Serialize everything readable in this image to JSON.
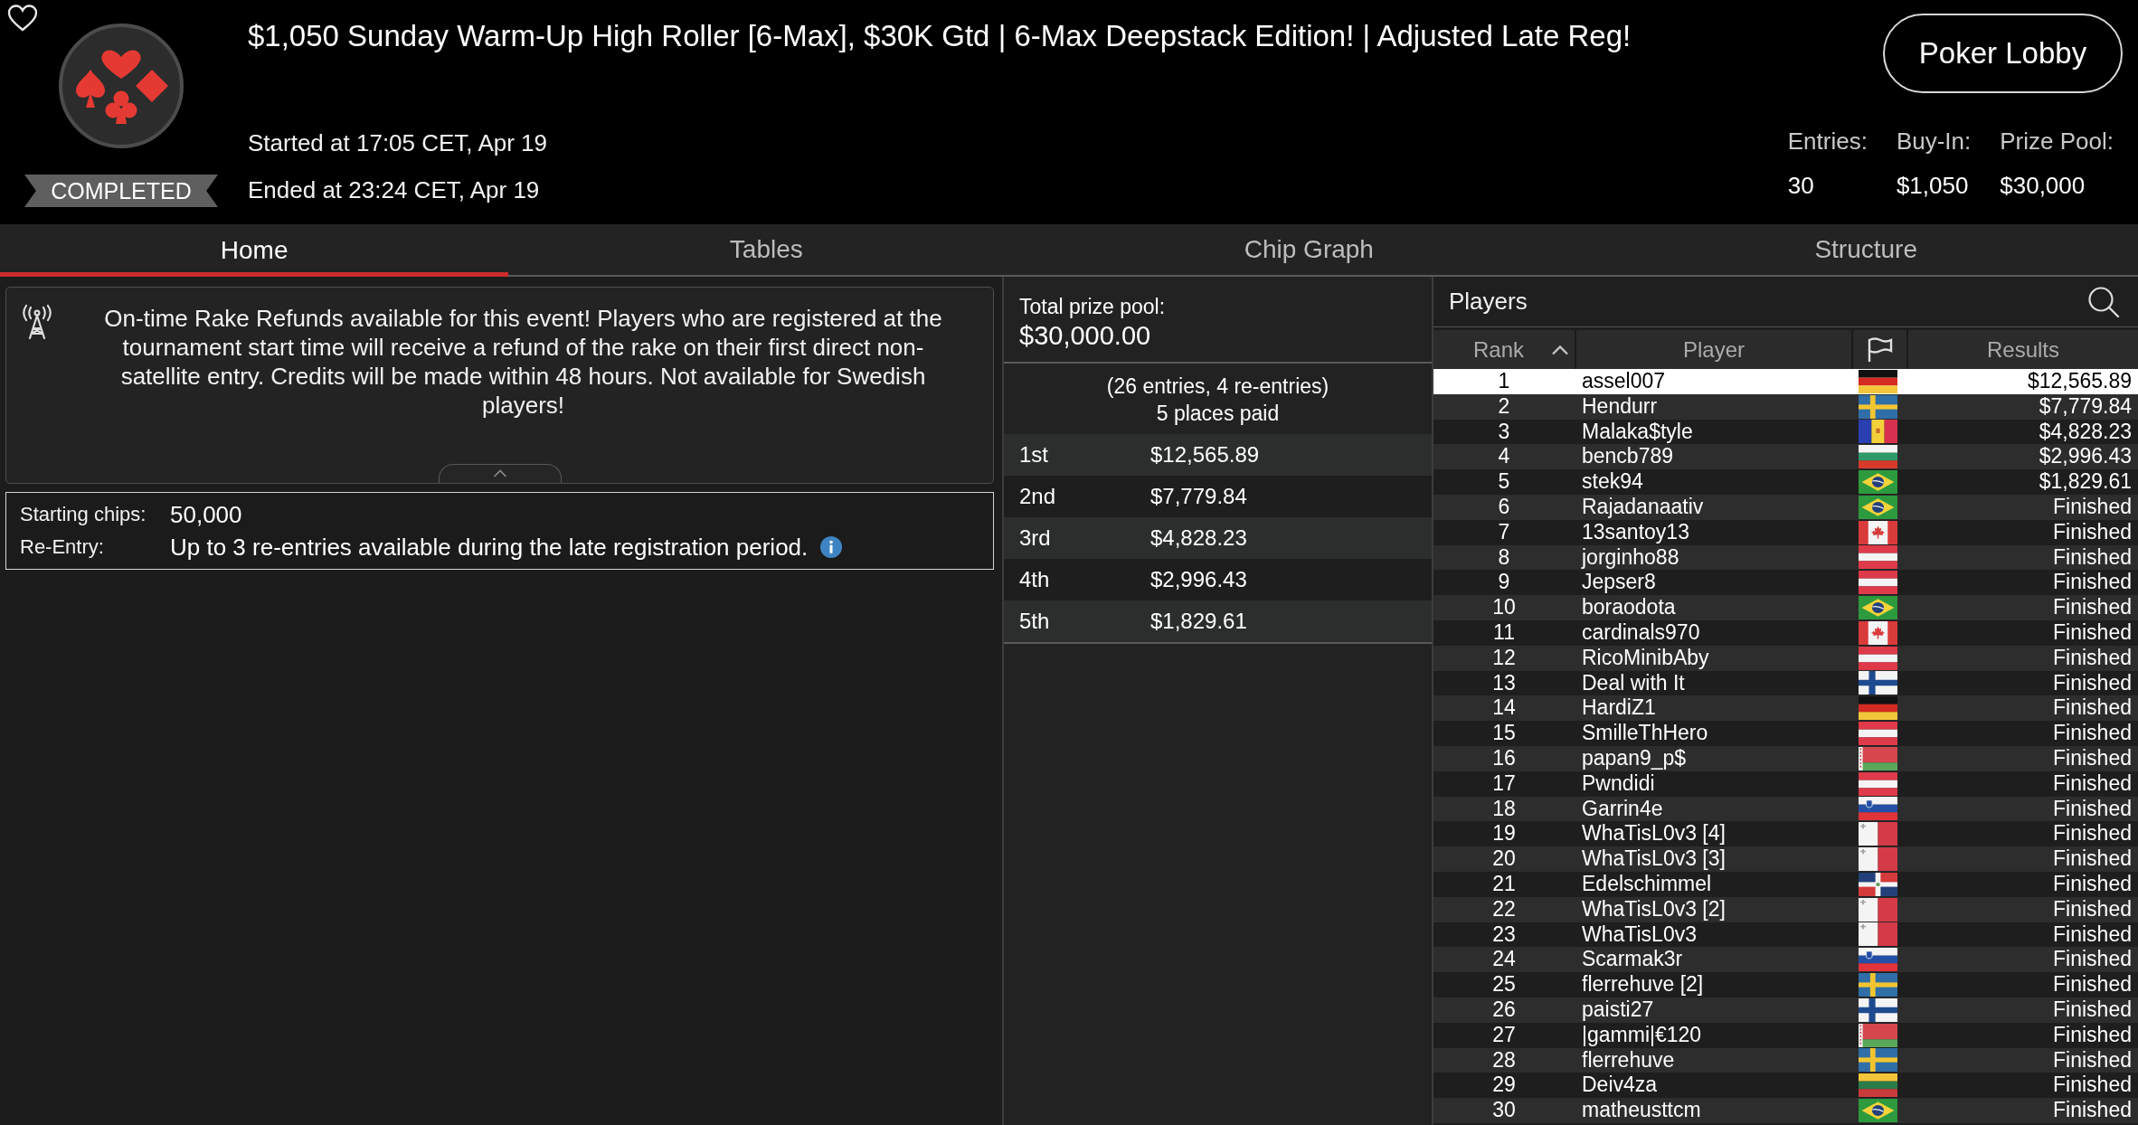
{
  "header": {
    "title": "$1,050 Sunday Warm-Up High Roller [6-Max], $30K Gtd | 6-Max Deepstack Edition! | Adjusted Late Reg!",
    "status": "COMPLETED",
    "started": "Started at 17:05 CET, Apr 19",
    "ended": "Ended at 23:24 CET, Apr 19",
    "lobby_button": "Poker Lobby",
    "stats": [
      {
        "label": "Entries:",
        "value": "30"
      },
      {
        "label": "Buy-In:",
        "value": "$1,050"
      },
      {
        "label": "Prize Pool:",
        "value": "$30,000"
      }
    ]
  },
  "tabs": [
    {
      "label": "Home",
      "selected": true
    },
    {
      "label": "Tables",
      "selected": false
    },
    {
      "label": "Chip Graph",
      "selected": false
    },
    {
      "label": "Structure",
      "selected": false
    }
  ],
  "notice": {
    "text": "On-time Rake Refunds available for this event! Players who are registered at the tournament start time will receive a refund of the rake on their first direct non-satellite entry. Credits will be made within 48 hours. Not available for Swedish players!",
    "expanded": true
  },
  "details": [
    {
      "label": "Starting chips:",
      "value": "50,000",
      "info": false
    },
    {
      "label": "Re-Entry:",
      "value": "Up to 3 re-entries available during the late registration period.",
      "info": true
    }
  ],
  "prize_pool": {
    "label": "Total prize pool:",
    "amount": "$30,000.00",
    "entries_note": "(26 entries, 4 re-entries)",
    "places_paid": "5 places paid",
    "payouts": [
      {
        "place": "1st",
        "amount": "$12,565.89"
      },
      {
        "place": "2nd",
        "amount": "$7,779.84"
      },
      {
        "place": "3rd",
        "amount": "$4,828.23"
      },
      {
        "place": "4th",
        "amount": "$2,996.43"
      },
      {
        "place": "5th",
        "amount": "$1,829.61"
      }
    ]
  },
  "players": {
    "title": "Players",
    "columns": [
      {
        "kind": "text",
        "label": "Rank",
        "sorted": true
      },
      {
        "kind": "text",
        "label": "Player",
        "sorted": false
      },
      {
        "kind": "flag"
      },
      {
        "kind": "text",
        "label": "Results",
        "sorted": false
      }
    ],
    "rows": [
      {
        "rank": "1",
        "player": "assel007",
        "flag": {
          "kind": "germany"
        },
        "result": "$12,565.89",
        "selected": true
      },
      {
        "rank": "2",
        "player": "Hendurr",
        "flag": {
          "kind": "sweden"
        },
        "result": "$7,779.84",
        "selected": false
      },
      {
        "rank": "3",
        "player": "Malaka$tyle",
        "flag": {
          "kind": "andorra"
        },
        "result": "$4,828.23",
        "selected": false
      },
      {
        "rank": "4",
        "player": "bencb789",
        "flag": {
          "kind": "bulgaria"
        },
        "result": "$2,996.43",
        "selected": false
      },
      {
        "rank": "5",
        "player": "stek94",
        "flag": {
          "kind": "brazil"
        },
        "result": "$1,829.61",
        "selected": false
      },
      {
        "rank": "6",
        "player": "Rajadanaativ",
        "flag": {
          "kind": "brazil"
        },
        "result": "Finished",
        "selected": false
      },
      {
        "rank": "7",
        "player": "13santoy13",
        "flag": {
          "kind": "canada"
        },
        "result": "Finished",
        "selected": false
      },
      {
        "rank": "8",
        "player": "jorginho88",
        "flag": {
          "kind": "austria"
        },
        "result": "Finished",
        "selected": false
      },
      {
        "rank": "9",
        "player": "Jepser8",
        "flag": {
          "kind": "austria"
        },
        "result": "Finished",
        "selected": false
      },
      {
        "rank": "10",
        "player": "boraodota",
        "flag": {
          "kind": "brazil"
        },
        "result": "Finished",
        "selected": false
      },
      {
        "rank": "11",
        "player": "cardinals970",
        "flag": {
          "kind": "canada"
        },
        "result": "Finished",
        "selected": false
      },
      {
        "rank": "12",
        "player": "RicoMinibAby",
        "flag": {
          "kind": "austria"
        },
        "result": "Finished",
        "selected": false
      },
      {
        "rank": "13",
        "player": "Deal with It",
        "flag": {
          "kind": "finland"
        },
        "result": "Finished",
        "selected": false
      },
      {
        "rank": "14",
        "player": "HardiZ1",
        "flag": {
          "kind": "germany"
        },
        "result": "Finished",
        "selected": false
      },
      {
        "rank": "15",
        "player": "SmilleThHero",
        "flag": {
          "kind": "austria"
        },
        "result": "Finished",
        "selected": false
      },
      {
        "rank": "16",
        "player": "papan9_p$",
        "flag": {
          "kind": "belarus"
        },
        "result": "Finished",
        "selected": false
      },
      {
        "rank": "17",
        "player": "Pwndidi",
        "flag": {
          "kind": "austria"
        },
        "result": "Finished",
        "selected": false
      },
      {
        "rank": "18",
        "player": "Garrin4e",
        "flag": {
          "kind": "slovenia"
        },
        "result": "Finished",
        "selected": false
      },
      {
        "rank": "19",
        "player": "WhaTisL0v3 [4]",
        "flag": {
          "kind": "malta"
        },
        "result": "Finished",
        "selected": false
      },
      {
        "rank": "20",
        "player": "WhaTisL0v3 [3]",
        "flag": {
          "kind": "malta"
        },
        "result": "Finished",
        "selected": false
      },
      {
        "rank": "21",
        "player": "Edelschimmel",
        "flag": {
          "kind": "dominican"
        },
        "result": "Finished",
        "selected": false
      },
      {
        "rank": "22",
        "player": "WhaTisL0v3 [2]",
        "flag": {
          "kind": "malta"
        },
        "result": "Finished",
        "selected": false
      },
      {
        "rank": "23",
        "player": "WhaTisL0v3",
        "flag": {
          "kind": "malta"
        },
        "result": "Finished",
        "selected": false
      },
      {
        "rank": "24",
        "player": "Scarmak3r",
        "flag": {
          "kind": "slovenia"
        },
        "result": "Finished",
        "selected": false
      },
      {
        "rank": "25",
        "player": "flerrehuve [2]",
        "flag": {
          "kind": "sweden"
        },
        "result": "Finished",
        "selected": false
      },
      {
        "rank": "26",
        "player": "paisti27",
        "flag": {
          "kind": "finland"
        },
        "result": "Finished",
        "selected": false
      },
      {
        "rank": "27",
        "player": "|gammi|€120",
        "flag": {
          "kind": "belarus"
        },
        "result": "Finished",
        "selected": false
      },
      {
        "rank": "28",
        "player": "flerrehuve",
        "flag": {
          "kind": "sweden"
        },
        "result": "Finished",
        "selected": false
      },
      {
        "rank": "29",
        "player": "Deiv4za",
        "flag": {
          "kind": "lithuania"
        },
        "result": "Finished",
        "selected": false
      },
      {
        "rank": "30",
        "player": "matheusttcm",
        "flag": {
          "kind": "brazil"
        },
        "result": "Finished",
        "selected": false
      }
    ]
  }
}
